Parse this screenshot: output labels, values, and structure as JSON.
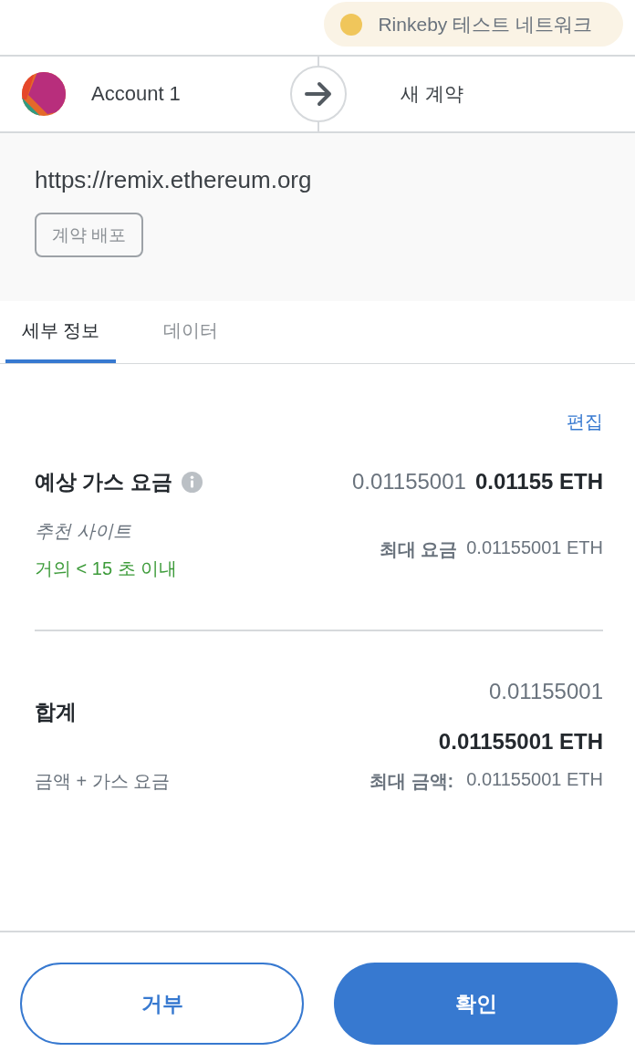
{
  "network": {
    "label": "Rinkeby 테스트 네트워크"
  },
  "transfer": {
    "from": "Account 1",
    "to": "새 계약"
  },
  "origin": {
    "url": "https://remix.ethereum.org",
    "action": "계약 배포"
  },
  "tabs": [
    {
      "label": "세부 정보",
      "selected": true
    },
    {
      "label": "데이터",
      "selected": false
    }
  ],
  "edit_link": "편집",
  "gas_fee": {
    "label": "예상 가스 요금",
    "secondary_amount": "0.01155001",
    "primary_amount": "0.01155 ETH",
    "speed_label": "추천 사이트",
    "speed_estimate": "거의 < 15 초 이내",
    "max_label": "최대 요금",
    "max_amount": "0.01155001 ETH"
  },
  "total": {
    "label": "합계",
    "secondary_amount": "0.01155001",
    "primary_amount": "0.01155001 ETH",
    "sublabel": "금액 + 가스 요금",
    "max_label": "최대 금액:",
    "max_amount": "0.01155001 ETH"
  },
  "buttons": [
    {
      "label": "거부",
      "kind": "reject"
    },
    {
      "label": "확인",
      "kind": "confirm"
    }
  ]
}
